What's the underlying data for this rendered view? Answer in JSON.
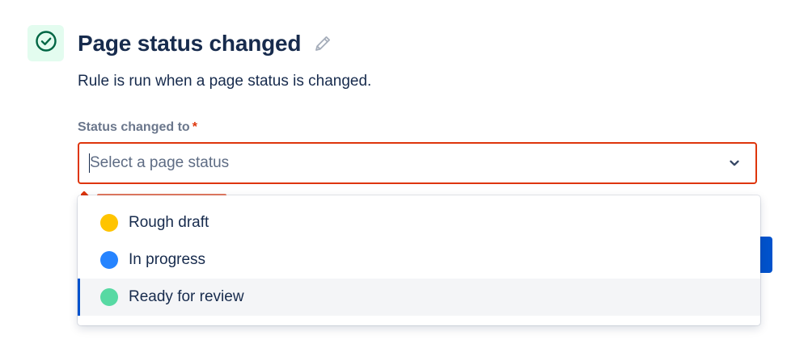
{
  "trigger": {
    "title": "Page status changed",
    "description": "Rule is run when a page status is changed.",
    "icon": "check-circle-icon",
    "edit_icon": "pencil-icon"
  },
  "field": {
    "label": "Status changed to",
    "required_marker": "*",
    "placeholder": "Select a page status",
    "dropdown_icon": "chevron-down-icon"
  },
  "menu": {
    "options": [
      {
        "label": "Rough draft",
        "color": "#ffc400"
      },
      {
        "label": "In progress",
        "color": "#2684ff"
      },
      {
        "label": "Ready for review",
        "color": "#57d9a3"
      }
    ],
    "highlighted_index": 2
  },
  "colors": {
    "accent": "#0052cc",
    "error": "#de350b",
    "success": "#006644"
  }
}
